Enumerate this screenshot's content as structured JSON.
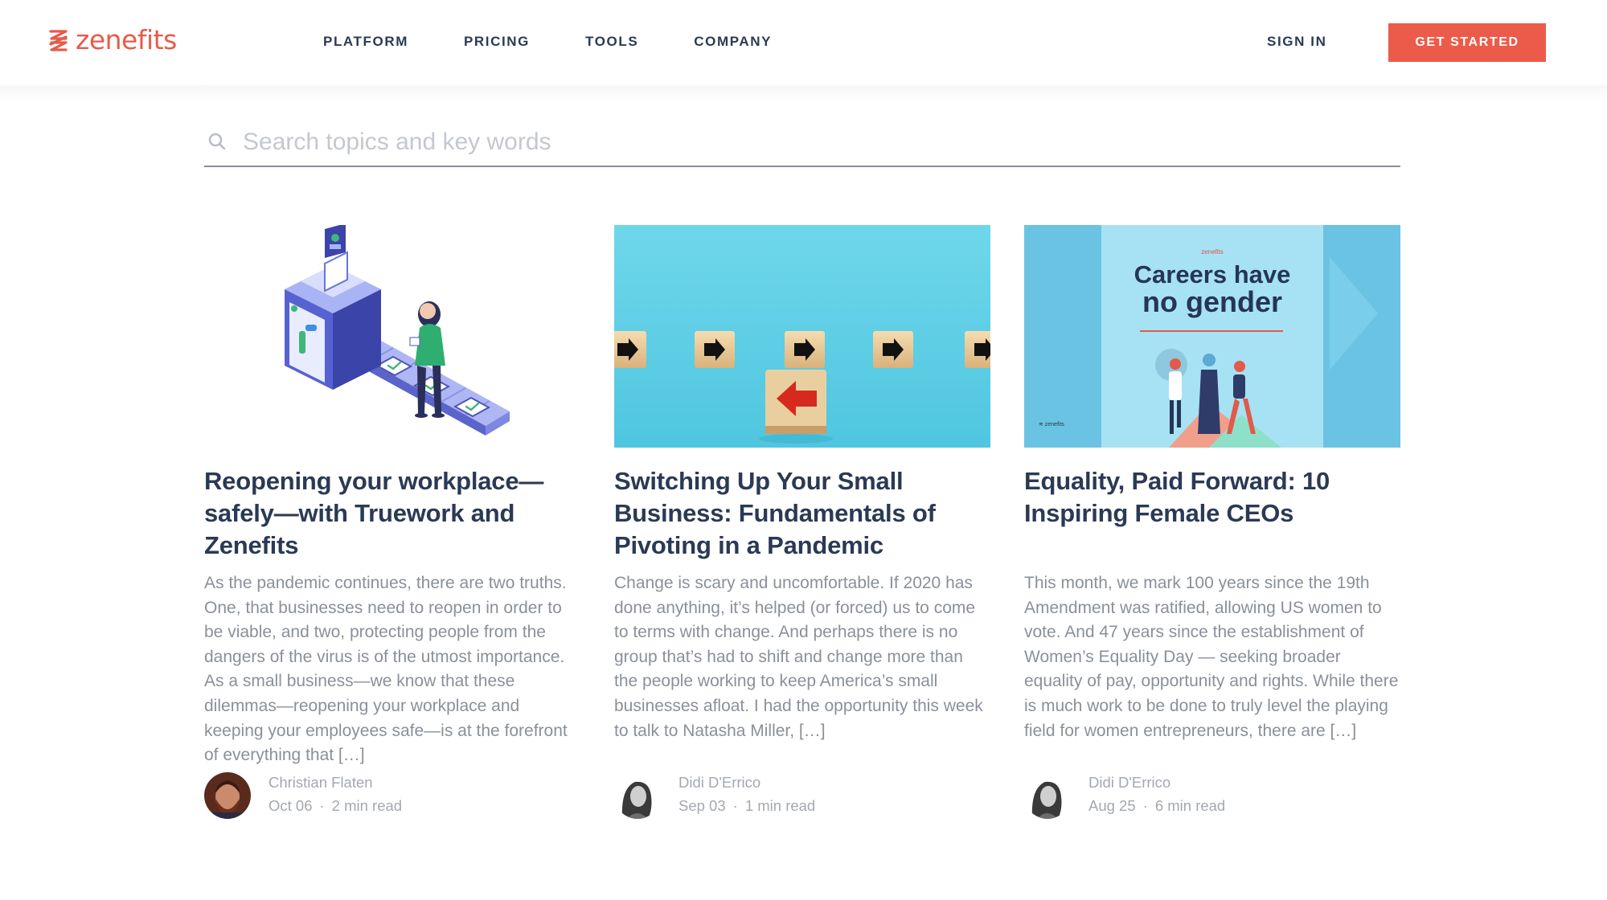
{
  "header": {
    "brand": "zenefits",
    "brand_color": "#e75b4a",
    "nav": [
      "PLATFORM",
      "PRICING",
      "TOOLS",
      "COMPANY"
    ],
    "sign_in": "SIGN IN",
    "cta": "GET STARTED",
    "cta_color": "#ec5b49"
  },
  "search": {
    "placeholder": "Search topics and key words",
    "icon": "search-icon"
  },
  "cards": [
    {
      "title": "Reopening your workplace—safely—with Truework and Zenefits",
      "excerpt": "As the pandemic continues, there are two truths. One, that businesses need to reopen in order to be viable, and two, protecting people from the dangers of the virus is of the utmost importance. As a small business—we know that these dilemmas—reopening your workplace and keeping your employees safe—is at the forefront of everything that […]",
      "author": "Christian Flaten",
      "date": "Oct 06",
      "read_time": "2 min read",
      "image": "isometric-document-machine-illustration"
    },
    {
      "title": "Switching Up Your Small Business: Fundamentals of Pivoting in a Pandemic",
      "excerpt": "Change is scary and uncomfortable. If 2020 has done anything, it’s helped (or forced) us to come to terms with change. And perhaps there is no group that’s had to shift and change more than the people working to keep America’s small businesses afloat. I had the opportunity this week to talk to Natasha Miller, […]",
      "author": "Didi D'Errico",
      "date": "Sep 03",
      "read_time": "1 min read",
      "image": "wooden-arrow-blocks-photo"
    },
    {
      "title": "Equality, Paid Forward: 10 Inspiring Female CEOs",
      "excerpt": "This month, we mark 100 years since the 19th Amendment was ratified, allowing US women to vote. And 47 years since the establishment of Women’s Equality Day — seeking broader equality of pay, opportunity and rights. While there is much work to be done to truly level the playing field for women entrepreneurs, there are […]",
      "author": "Didi D'Errico",
      "date": "Aug 25",
      "read_time": "6 min read",
      "image": "careers-have-no-gender-poster",
      "image_headline_1": "Careers have",
      "image_headline_2": "no gender",
      "image_brand": "zenefits",
      "image_brand_small": "≋ zenefits"
    }
  ]
}
